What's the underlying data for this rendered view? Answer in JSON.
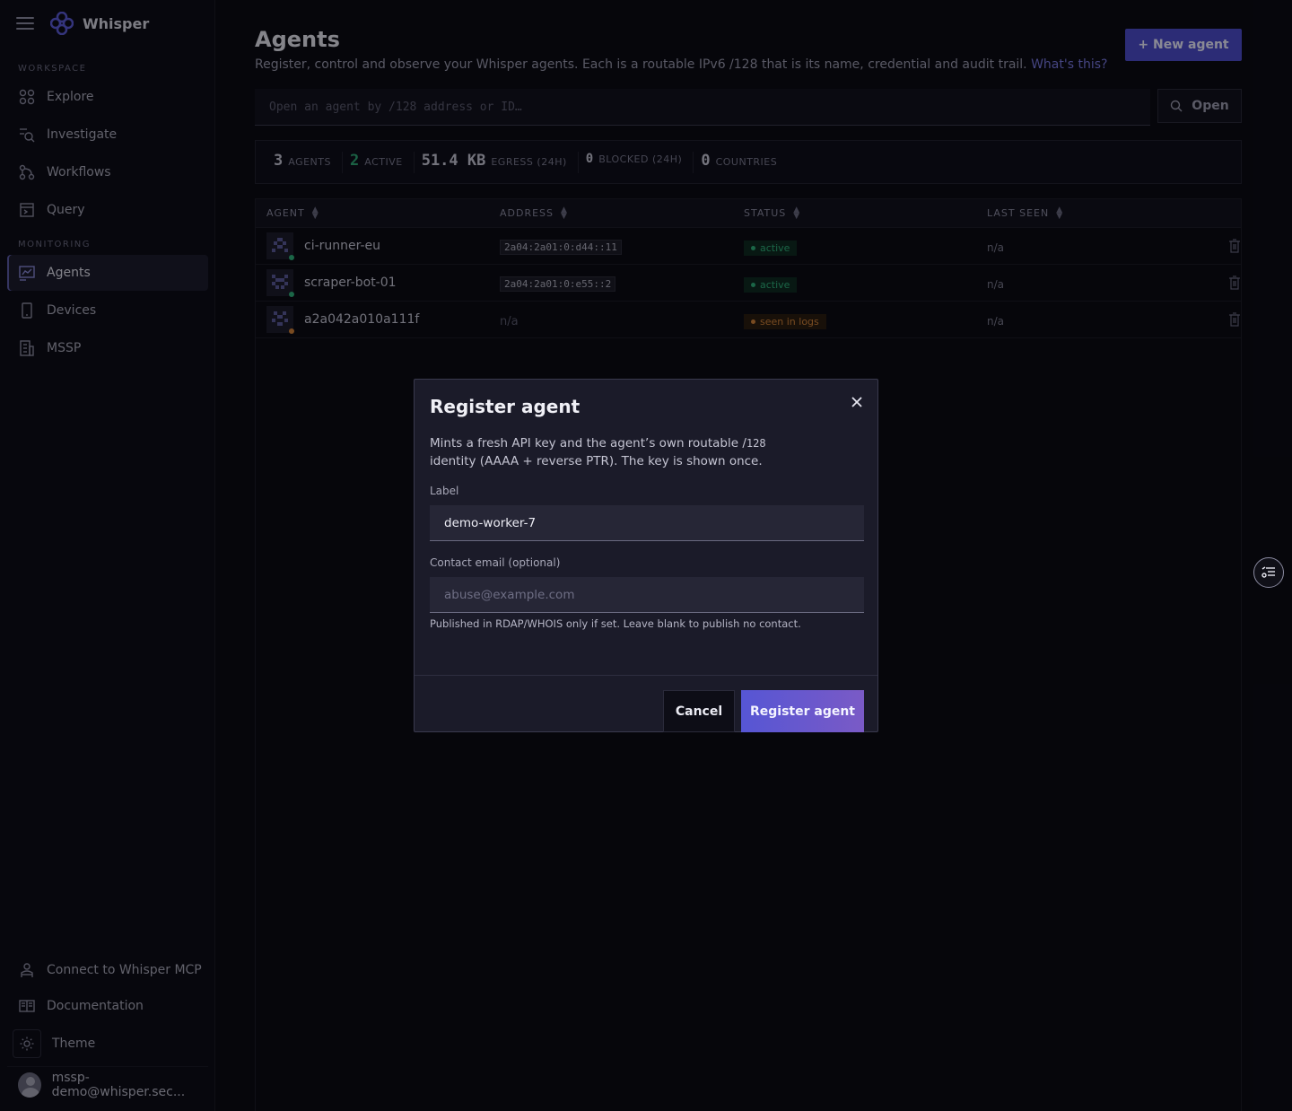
{
  "app": {
    "name": "Whisper"
  },
  "sidebar": {
    "sections": [
      {
        "label": "WORKSPACE",
        "items": [
          {
            "label": "Explore",
            "icon": "explore-icon"
          },
          {
            "label": "Investigate",
            "icon": "investigate-icon"
          },
          {
            "label": "Workflows",
            "icon": "workflows-icon"
          },
          {
            "label": "Query",
            "icon": "query-icon"
          }
        ]
      },
      {
        "label": "MONITORING",
        "items": [
          {
            "label": "Agents",
            "icon": "agents-icon",
            "active": true
          },
          {
            "label": "Devices",
            "icon": "devices-icon"
          },
          {
            "label": "MSSP",
            "icon": "mssp-icon"
          }
        ]
      }
    ],
    "bottom": {
      "mcp": "Connect to Whisper MCP",
      "docs": "Documentation",
      "theme": "Theme",
      "user": "mssp-demo@whisper.sec..."
    }
  },
  "page": {
    "title": "Agents",
    "description": "Register, control and observe your Whisper agents. Each is a routable IPv6 /128 that is its name, credential and audit trail.",
    "link": "What's this?",
    "new_agent_button": "+ New agent",
    "search_placeholder": "Open an agent by /128 address or ID…",
    "open_button": "Open"
  },
  "stats": [
    {
      "value": "3",
      "label": "AGENTS"
    },
    {
      "value": "2",
      "label": "ACTIVE"
    },
    {
      "value": "51.4 KB",
      "label": "EGRESS",
      "sub": "(24H)"
    },
    {
      "value": "0",
      "label": "BLOCKED",
      "sub": "(24H)"
    },
    {
      "value": "0",
      "label": "COUNTRIES"
    }
  ],
  "table": {
    "columns": [
      "AGENT",
      "ADDRESS",
      "STATUS",
      "LAST SEEN"
    ],
    "rows": [
      {
        "name": "ci-runner-eu",
        "address": "2a04:2a01:0:d44::11",
        "status": "active",
        "last_seen": "n/a"
      },
      {
        "name": "scraper-bot-01",
        "address": "2a04:2a01:0:e55::2",
        "status": "active",
        "last_seen": "n/a"
      },
      {
        "name": "a2a042a010a111f",
        "address": "n/a",
        "status": "seen in logs",
        "last_seen": "n/a"
      }
    ]
  },
  "modal": {
    "title": "Register agent",
    "desc_part1": "Mints a fresh API key and the agent’s own routable /",
    "desc_code": "128",
    "desc_part2": "identity (AAAA + reverse PTR). The key is shown once.",
    "label_field_label": "Label",
    "label_field_value": "demo-worker-7",
    "email_field_label": "Contact email (optional)",
    "email_placeholder": "abuse@example.com",
    "helper": "Published in RDAP/WHOIS only if set. Leave blank to publish no contact.",
    "cancel": "Cancel",
    "submit": "Register agent"
  },
  "colors": {
    "accent": "#5656d4",
    "active": "#2fb07a",
    "warning": "#d0823a"
  }
}
